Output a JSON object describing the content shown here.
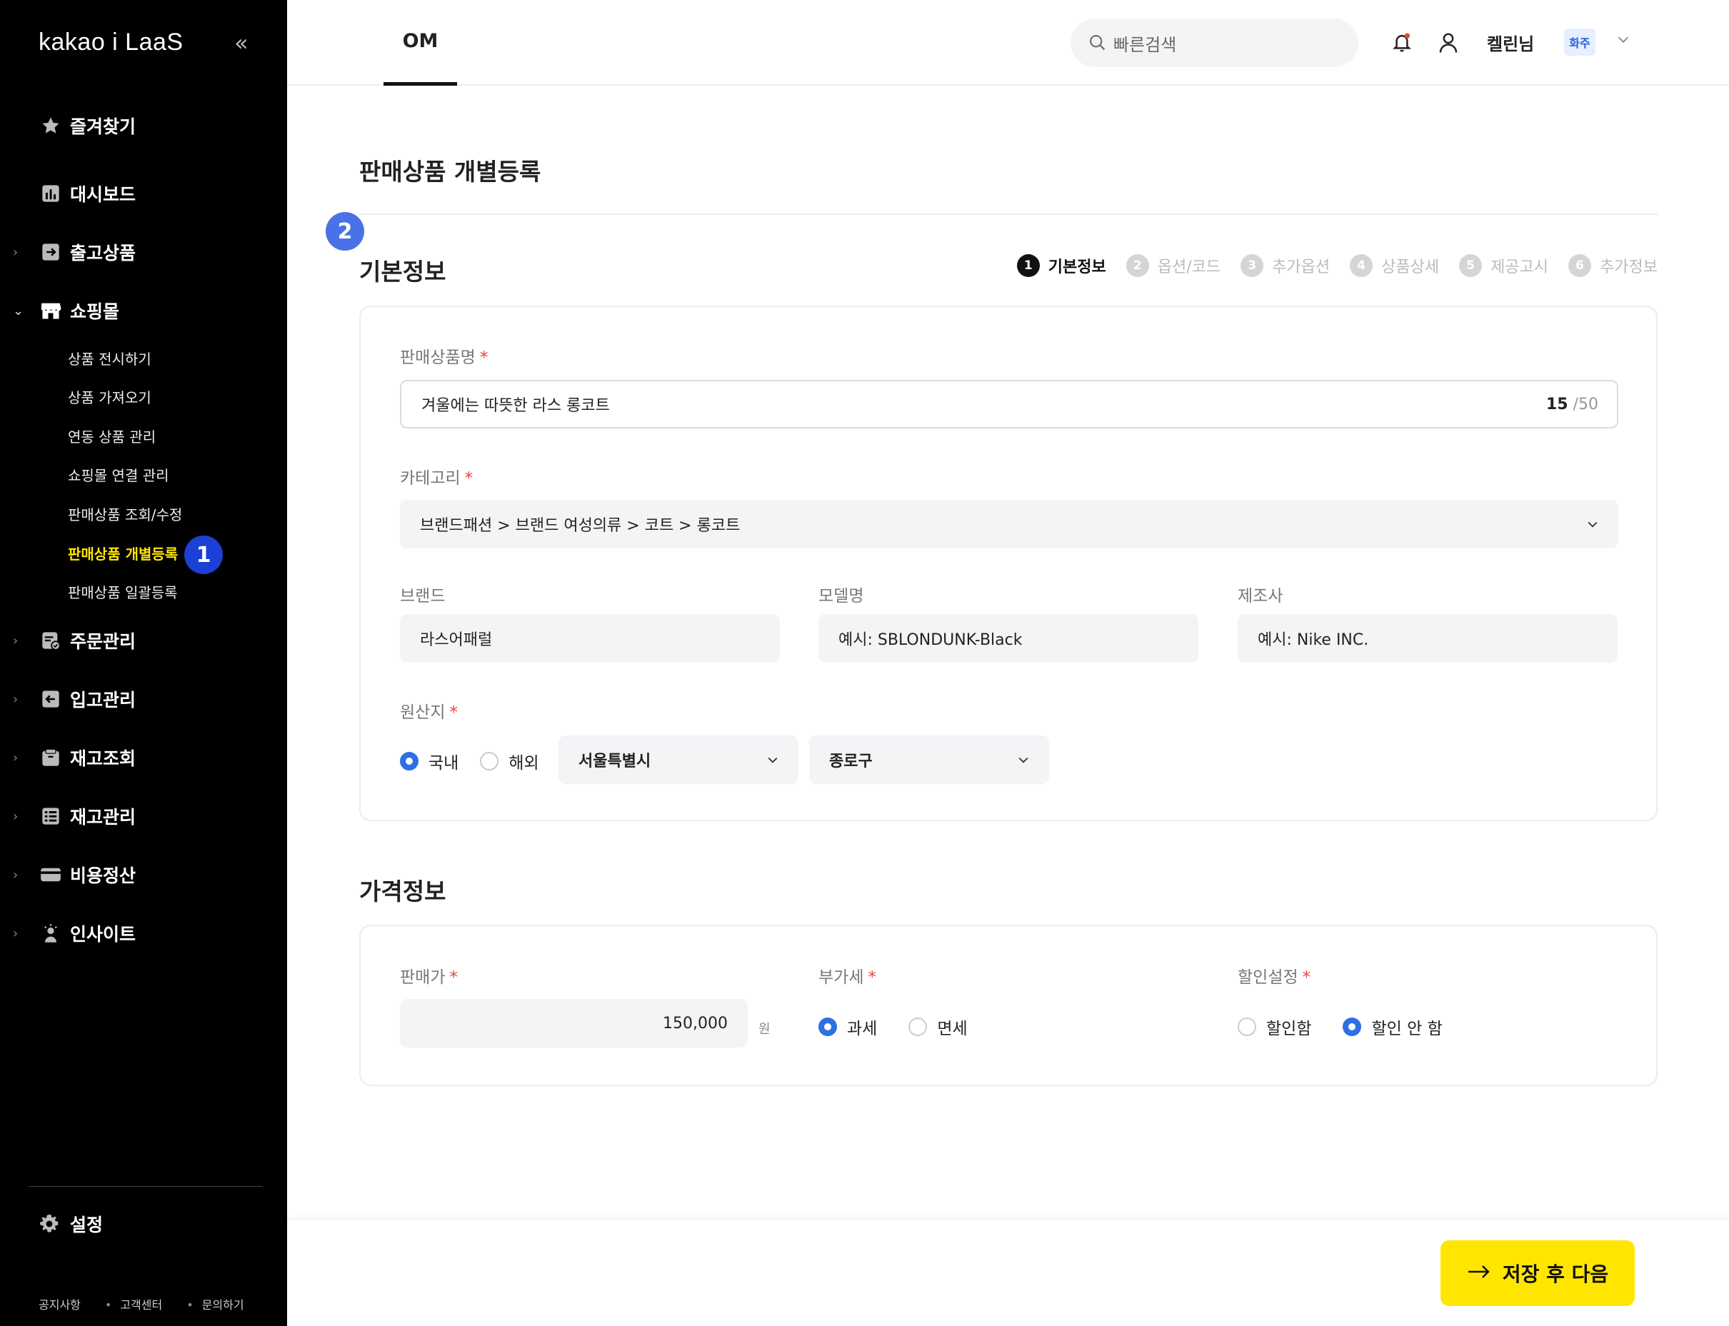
{
  "sidebar": {
    "logo": "kakao i LaaS",
    "collapse_icon": "double-chevron-left-icon",
    "items": [
      {
        "label": "즐겨찾기",
        "icon": "star-icon"
      },
      {
        "label": "대시보드",
        "icon": "bar-chart-icon"
      },
      {
        "label": "출고상품",
        "icon": "outbound-icon"
      },
      {
        "label": "쇼핑몰",
        "icon": "store-icon"
      },
      {
        "label": "주문관리",
        "icon": "order-icon"
      },
      {
        "label": "입고관리",
        "icon": "inbound-icon"
      },
      {
        "label": "재고조회",
        "icon": "inventory-search-icon"
      },
      {
        "label": "재고관리",
        "icon": "inventory-list-icon"
      },
      {
        "label": "비용정산",
        "icon": "card-icon"
      },
      {
        "label": "인사이트",
        "icon": "insight-icon"
      }
    ],
    "sub_items": [
      "상품 전시하기",
      "상품 가져오기",
      "연동 상품 관리",
      "쇼핑몰 연결 관리",
      "판매상품 조회/수정",
      "판매상품 개별등록",
      "판매상품 일괄등록"
    ],
    "active_sub_badge": "1",
    "settings_label": "설정",
    "footer": [
      "공지사항",
      "고객센터",
      "문의하기"
    ]
  },
  "topbar": {
    "tab": "OM",
    "search_placeholder": "빠른검색",
    "username": "켈린님",
    "role": "화주"
  },
  "page": {
    "title": "판매상품 개별등록",
    "step_badge": "2"
  },
  "steps": [
    {
      "num": "1",
      "label": "기본정보"
    },
    {
      "num": "2",
      "label": "옵션/코드"
    },
    {
      "num": "3",
      "label": "추가옵션"
    },
    {
      "num": "4",
      "label": "상품상세"
    },
    {
      "num": "5",
      "label": "제공고시"
    },
    {
      "num": "6",
      "label": "추가정보"
    }
  ],
  "basic": {
    "section_title": "기본정보",
    "name_label": "판매상품명",
    "name_value": "겨울에는 따뜻한 라스 롱코트",
    "name_count": "15",
    "name_max": "/50",
    "category_label": "카테고리",
    "category_value": "브랜드패션 > 브랜드 여성의류 > 코트 > 롱코트",
    "brand_label": "브랜드",
    "brand_value": "라스어패럴",
    "model_label": "모델명",
    "model_placeholder": "예시: SBLONDUNK-Black",
    "maker_label": "제조사",
    "maker_placeholder": "예시: Nike INC.",
    "origin_label": "원산지",
    "origin_domestic": "국내",
    "origin_overseas": "해외",
    "origin_city": "서울특별시",
    "origin_district": "종로구"
  },
  "price": {
    "section_title": "가격정보",
    "price_label": "판매가",
    "price_value": "150,000",
    "price_unit": "원",
    "vat_label": "부가세",
    "vat_taxable": "과세",
    "vat_exempt": "면세",
    "discount_label": "할인설정",
    "discount_on": "할인함",
    "discount_off": "할인 안 함"
  },
  "actions": {
    "save_next": "저장 후 다음"
  },
  "colors": {
    "accent_yellow": "#ffe600",
    "radio_blue": "#2f6fe5",
    "badge_blue": "#1c3fd6",
    "required_red": "#e2473a"
  }
}
